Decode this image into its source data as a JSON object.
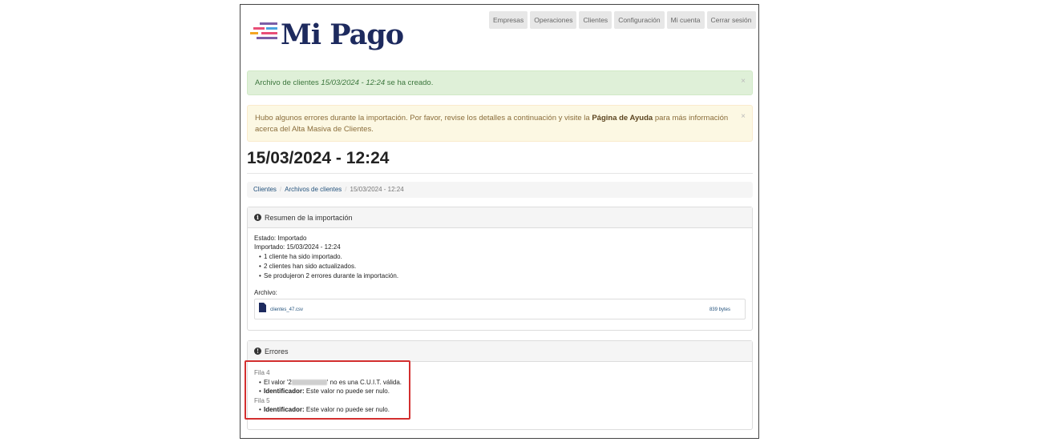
{
  "brand": {
    "name": "Mi Pago",
    "color": "#1d2a5e",
    "stripe_colors": [
      "#e94e77",
      "#f5a623",
      "#7b5ea7",
      "#4aa3df"
    ]
  },
  "nav": [
    "Empresas",
    "Operaciones",
    "Clientes",
    "Configuración",
    "Mi cuenta",
    "Cerrar sesión"
  ],
  "alerts": {
    "success": {
      "text_before": "Archivo de clientes ",
      "text_emph": "15/03/2024 - 12:24",
      "text_after": " se ha creado.",
      "close": "×"
    },
    "warning": {
      "text_before": "Hubo algunos errores durante la importación. Por favor, revise los detalles a continuación y visite la ",
      "link": "Página de Ayuda",
      "text_after": " para más información acerca del Alta Masiva de Clientes.",
      "close": "×"
    }
  },
  "page_title": "15/03/2024 - 12:24",
  "breadcrumb": {
    "items": [
      "Clientes",
      "Archivos de clientes"
    ],
    "separator": "/",
    "active": "15/03/2024 - 12:24"
  },
  "summary": {
    "heading": "Resumen de la importación",
    "icon": "info-icon",
    "estado_label": "Estado:",
    "estado_value": "Importado",
    "importado_label": "Importado:",
    "importado_value": "15/03/2024 - 12:24",
    "bullets": [
      "1 cliente ha sido importado.",
      "2 clientes han sido actualizados.",
      "Se produjeron 2 errores durante la importación."
    ],
    "archivo_label": "Archivo:",
    "file_name": "clientes_47.csv",
    "file_size": "839 bytes"
  },
  "errors": {
    "heading": "Errores",
    "icon": "exclamation-icon",
    "groups": [
      {
        "fila": "Fila 4",
        "items": [
          {
            "before": "El valor '2",
            "after": "' no es una C.U.I.T. válida."
          },
          {
            "label": "Identificador:",
            "text": "Este valor no puede ser nulo."
          }
        ]
      },
      {
        "fila": "Fila 5",
        "items": [
          {
            "label": "Identificador:",
            "text": "Este valor no puede ser nulo."
          }
        ]
      }
    ]
  },
  "highlight_color": "#d32f2f"
}
